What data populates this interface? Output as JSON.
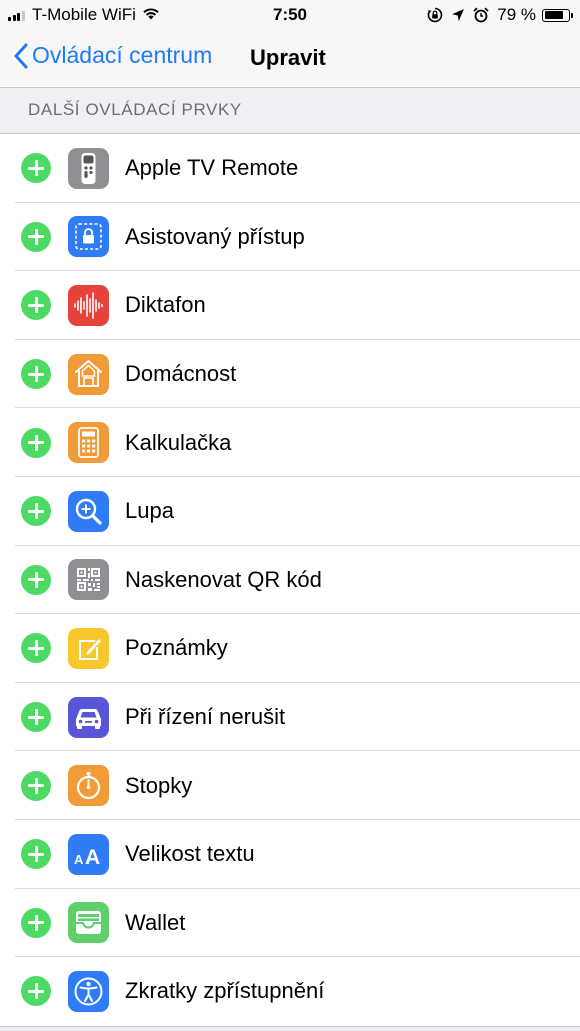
{
  "status_bar": {
    "carrier": "T-Mobile WiFi",
    "time": "7:50",
    "battery_percent": "79 %",
    "battery_level": 0.79
  },
  "nav": {
    "back_label": "Ovládací centrum",
    "title": "Upravit"
  },
  "section": {
    "header": "DALŠÍ OVLÁDACÍ PRVKY"
  },
  "controls": [
    {
      "label": "Apple TV Remote",
      "icon": "apple-tv-remote-icon",
      "color": "#8e8e93"
    },
    {
      "label": "Asistovaný přístup",
      "icon": "guided-access-icon",
      "color": "#2f7cf6"
    },
    {
      "label": "Diktafon",
      "icon": "voice-memos-icon",
      "color": "#e8433b"
    },
    {
      "label": "Domácnost",
      "icon": "home-icon",
      "color": "#f19a38"
    },
    {
      "label": "Kalkulačka",
      "icon": "calculator-icon",
      "color": "#f19a38"
    },
    {
      "label": "Lupa",
      "icon": "magnifier-icon",
      "color": "#2f7cf6"
    },
    {
      "label": "Naskenovat QR kód",
      "icon": "qr-code-icon",
      "color": "#8e8e93"
    },
    {
      "label": "Poznámky",
      "icon": "notes-icon",
      "color": "#f7c82e"
    },
    {
      "label": "Při řízení nerušit",
      "icon": "car-icon",
      "color": "#5856d6"
    },
    {
      "label": "Stopky",
      "icon": "stopwatch-icon",
      "color": "#f19a38"
    },
    {
      "label": "Velikost textu",
      "icon": "text-size-icon",
      "color": "#2f7cf6"
    },
    {
      "label": "Wallet",
      "icon": "wallet-icon",
      "color": "#5fcf6a"
    },
    {
      "label": "Zkratky zpřístupnění",
      "icon": "accessibility-icon",
      "color": "#2f7cf6"
    }
  ]
}
